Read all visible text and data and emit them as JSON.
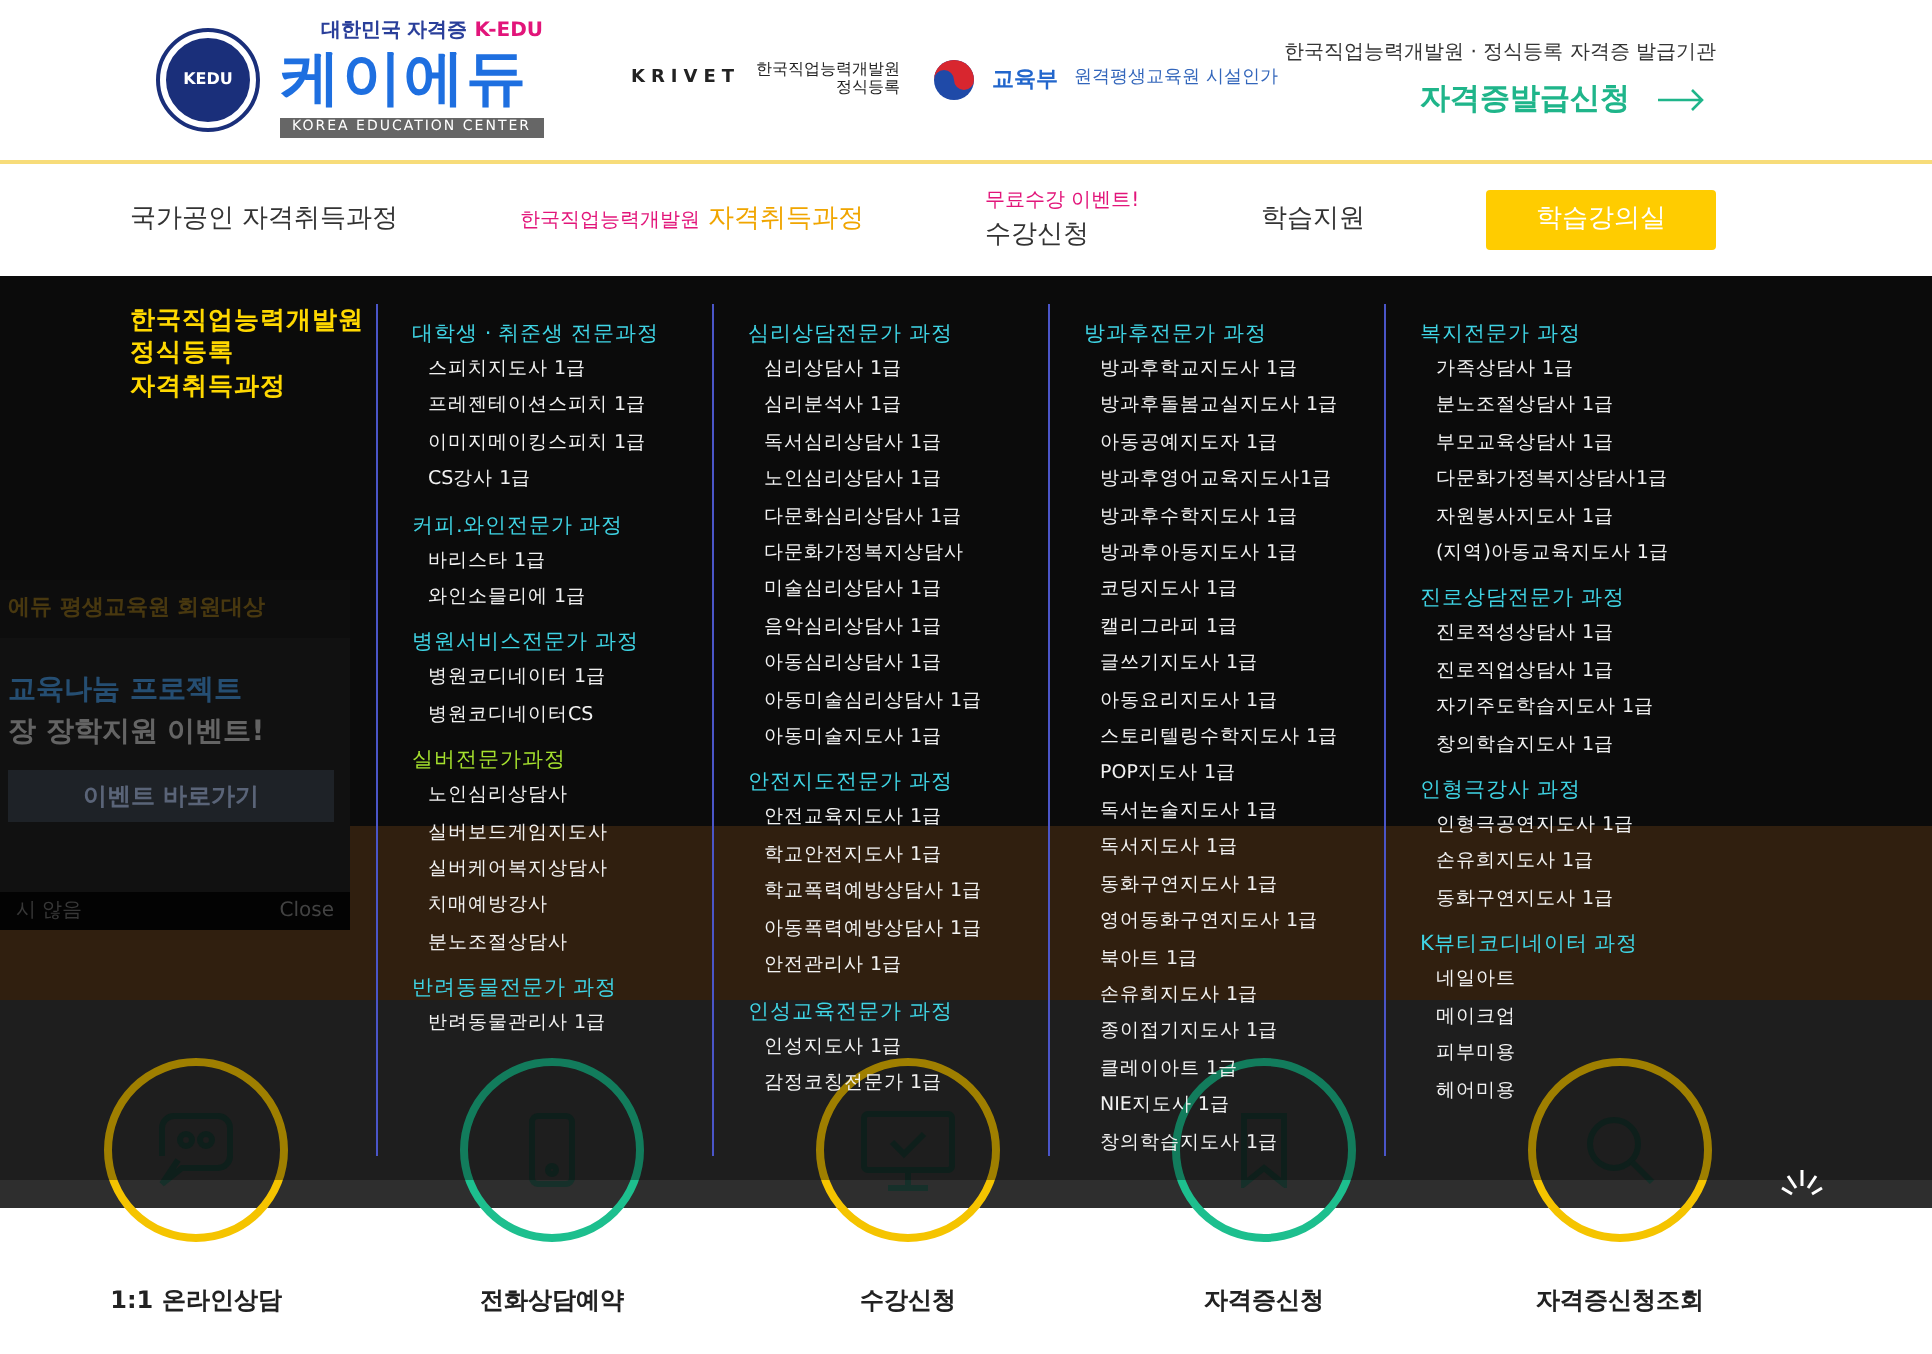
{
  "header": {
    "logo": {
      "emblem": "KEDU",
      "tagline": "대한민국 자격증",
      "tagline_brand": "K-EDU",
      "name": "케이에듀",
      "subtitle": "KOREA EDUCATION CENTER"
    },
    "partners": [
      {
        "kind": "krivet",
        "mark": "KRIVET",
        "name": "한국직업능력개발원",
        "note": "정식등록"
      },
      {
        "kind": "ministry",
        "name": "교육부",
        "note": "원격평생교육원 시설인가"
      }
    ],
    "cta": {
      "caption": "한국직업능력개발원 · 정식등록 자격증 발급기관",
      "label": "자격증발급신청"
    }
  },
  "nav": [
    {
      "kind": "plain",
      "label": "국가공인 자격취득과정"
    },
    {
      "kind": "split",
      "prefix": "한국직업능력개발원",
      "label": "자격취득과정"
    },
    {
      "kind": "event",
      "badge": "무료수강 이벤트!",
      "label": "수강신청"
    },
    {
      "kind": "plain",
      "label": "학습지원"
    },
    {
      "kind": "button",
      "label": "학습강의실"
    }
  ],
  "popup": {
    "title": "에듀 평생교육원 회원대상",
    "headline": "교육나눔 프로젝트",
    "subline": "장 장학지원 이벤트!",
    "button": "이벤트 바로가기",
    "dismiss": "시 않음",
    "close": "Close"
  },
  "mega_menu": {
    "title": [
      "한국직업능력개발원",
      "정식등록",
      "자격취득과정"
    ],
    "columns": [
      {
        "groups": [
          {
            "kind": "standard",
            "heading": "대학생 · 취준생 전문과정",
            "items": [
              "스피치지도사 1급",
              "프레젠테이션스피치 1급",
              "이미지메이킹스피치 1급",
              "CS강사 1급"
            ]
          },
          {
            "kind": "standard",
            "heading": "커피.와인전문가 과정",
            "items": [
              "바리스타 1급",
              "와인소믈리에 1급"
            ]
          },
          {
            "kind": "standard",
            "heading": "병원서비스전문가 과정",
            "items": [
              "병원코디네이터 1급",
              "병원코디네이터CS"
            ]
          },
          {
            "kind": "featured",
            "heading": "실버전문가과정",
            "items": [
              "노인심리상담사",
              "실버보드게임지도사",
              "실버케어복지상담사",
              "치매예방강사",
              "분노조절상담사"
            ]
          },
          {
            "kind": "standard",
            "heading": "반려동물전문가 과정",
            "items": [
              "반려동물관리사 1급"
            ]
          }
        ]
      },
      {
        "groups": [
          {
            "kind": "standard",
            "heading": "심리상담전문가 과정",
            "items": [
              "심리상담사 1급",
              "심리분석사 1급",
              "독서심리상담사 1급",
              "노인심리상담사 1급",
              "다문화심리상담사 1급",
              "다문화가정복지상담사",
              "미술심리상담사 1급",
              "음악심리상담사 1급",
              "아동심리상담사 1급",
              "아동미술심리상담사 1급",
              "아동미술지도사 1급"
            ]
          },
          {
            "kind": "standard",
            "heading": "안전지도전문가 과정",
            "items": [
              "안전교육지도사 1급",
              "학교안전지도사 1급",
              "학교폭력예방상담사 1급",
              "아동폭력예방상담사 1급",
              "안전관리사 1급"
            ]
          },
          {
            "kind": "standard",
            "heading": "인성교육전문가 과정",
            "items": [
              "인성지도사 1급",
              "감정코칭전문가 1급"
            ]
          }
        ]
      },
      {
        "groups": [
          {
            "kind": "standard",
            "heading": "방과후전문가 과정",
            "items": [
              "방과후학교지도사 1급",
              "방과후돌봄교실지도사 1급",
              "아동공예지도자 1급",
              "방과후영어교육지도사1급",
              "방과후수학지도사 1급",
              "방과후아동지도사 1급",
              "코딩지도사 1급",
              "캘리그라피 1급",
              "글쓰기지도사 1급",
              "아동요리지도사 1급",
              "스토리텔링수학지도사 1급",
              "POP지도사 1급",
              "독서논술지도사 1급",
              "독서지도사 1급",
              "동화구연지도사 1급",
              "영어동화구연지도사 1급",
              "북아트 1급",
              "손유희지도사 1급",
              "종이접기지도사 1급",
              "클레이아트 1급",
              "NIE지도사 1급",
              "창의학습지도사 1급"
            ]
          }
        ]
      },
      {
        "groups": [
          {
            "kind": "standard",
            "heading": "복지전문가 과정",
            "items": [
              "가족상담사 1급",
              "분노조절상담사 1급",
              "부모교육상담사 1급",
              "다문화가정복지상담사1급",
              "자원봉사지도사 1급",
              "(지역)아동교육지도사 1급"
            ]
          },
          {
            "kind": "standard",
            "heading": "진로상담전문가 과정",
            "items": [
              "진로적성상담사 1급",
              "진로직업상담사 1급",
              "자기주도학습지도사 1급",
              "창의학습지도사 1급"
            ]
          },
          {
            "kind": "standard",
            "heading": "인형극강사 과정",
            "items": [
              "인형극공연지도사 1급",
              "손유희지도사 1급",
              "동화구연지도사 1급"
            ]
          },
          {
            "kind": "standard",
            "heading": "K뷰티코디네이터 과정",
            "items": [
              "네일아트",
              "메이크업",
              "피부미용",
              "헤어미용"
            ]
          }
        ]
      }
    ]
  },
  "quick_links": [
    {
      "kind": "chat",
      "color": "#f5c400",
      "label": "1:1 온라인상담"
    },
    {
      "kind": "phone",
      "color": "#1dbf8e",
      "label": "전화상담예약"
    },
    {
      "kind": "monitor",
      "color": "#f5c400",
      "label": "수강신청"
    },
    {
      "kind": "bookmark",
      "color": "#1dbf8e",
      "label": "자격증신청"
    },
    {
      "kind": "search",
      "color": "#f5c400",
      "label": "자격증신청조회"
    }
  ]
}
